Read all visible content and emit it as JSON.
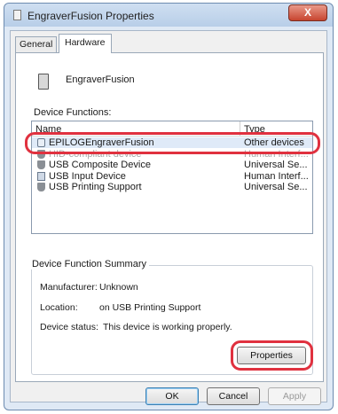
{
  "window": {
    "title": "EngraverFusion Properties",
    "close_label": "X"
  },
  "tabs": [
    {
      "label": "General"
    },
    {
      "label": "Hardware"
    }
  ],
  "device": {
    "name": "EngraverFusion",
    "icon": "printer-device-icon"
  },
  "device_functions": {
    "label": "Device Functions:",
    "columns": {
      "name": "Name",
      "type": "Type"
    },
    "rows": [
      {
        "name": "EPILOGEngraverFusion",
        "type": "Other devices",
        "icon": "unknown-device-icon"
      },
      {
        "name": "HID-compliant device",
        "type": "Human Interf...",
        "icon": "usb-plug-icon"
      },
      {
        "name": "USB Composite Device",
        "type": "Universal Se...",
        "icon": "usb-plug-icon"
      },
      {
        "name": "USB Input Device",
        "type": "Human Interf...",
        "icon": "usb-input-icon"
      },
      {
        "name": "USB Printing Support",
        "type": "Universal Se...",
        "icon": "usb-plug-icon"
      }
    ]
  },
  "summary": {
    "title": "Device Function Summary",
    "manufacturer_label": "Manufacturer:",
    "manufacturer_value": "Unknown",
    "location_label": "Location:",
    "location_value": "on USB Printing Support",
    "status_label": "Device status:",
    "status_value": "This device is working properly.",
    "properties_button": "Properties"
  },
  "footer": {
    "ok": "OK",
    "cancel": "Cancel",
    "apply": "Apply"
  },
  "colors": {
    "highlight": "#e0313f",
    "selection": "#dfeaf8",
    "close_button": "#c7452f"
  }
}
